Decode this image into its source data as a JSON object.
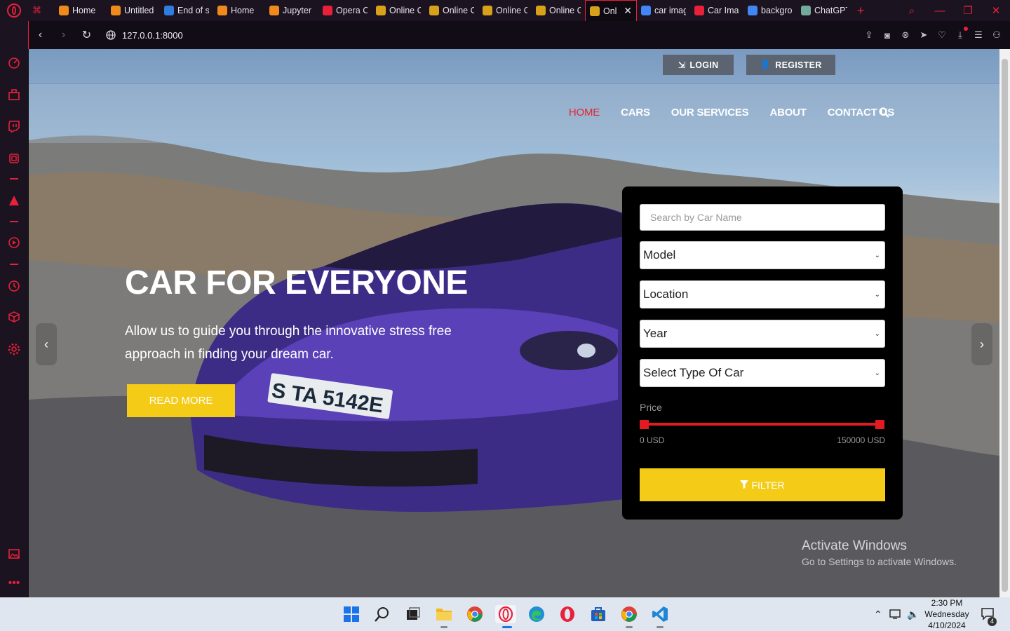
{
  "browser": {
    "tabs": [
      {
        "label": "Home",
        "color": "#f08a1c",
        "active": false
      },
      {
        "label": "Untitled",
        "color": "#f08a1c",
        "active": false
      },
      {
        "label": "End of s",
        "color": "#2f7de1",
        "active": false
      },
      {
        "label": "Home",
        "color": "#f08a1c",
        "active": false
      },
      {
        "label": "Jupyter",
        "color": "#f08a1c",
        "active": false
      },
      {
        "label": "Opera C",
        "color": "#e8203a",
        "active": false
      },
      {
        "label": "Online C",
        "color": "#d8a11a",
        "active": false
      },
      {
        "label": "Online C",
        "color": "#d8a11a",
        "active": false
      },
      {
        "label": "Online C",
        "color": "#d8a11a",
        "active": false
      },
      {
        "label": "Online C",
        "color": "#d8a11a",
        "active": false
      },
      {
        "label": "Onli",
        "color": "#d8a11a",
        "active": true
      },
      {
        "label": "car imag",
        "color": "#4285f4",
        "active": false
      },
      {
        "label": "Car Ima",
        "color": "#e8203a",
        "active": false
      },
      {
        "label": "backgro",
        "color": "#4285f4",
        "active": false
      },
      {
        "label": "ChatGPT",
        "color": "#74aa9c",
        "active": false
      }
    ],
    "url": "127.0.0.1:8000"
  },
  "header": {
    "login_label": "LOGIN",
    "register_label": "REGISTER"
  },
  "nav": {
    "items": [
      "HOME",
      "CARS",
      "OUR SERVICES",
      "ABOUT",
      "CONTACT US"
    ],
    "active": "HOME"
  },
  "hero": {
    "title": "CAR FOR EVERYONE",
    "subtitle": "Allow us to guide you through the innovative stress free approach in finding your dream car.",
    "cta_label": "READ MORE",
    "plate_text": "S TA 5142E"
  },
  "filter": {
    "search_placeholder": "Search by Car Name",
    "model_label": "Model",
    "location_label": "Location",
    "year_label": "Year",
    "type_label": "Select Type Of Car",
    "price_label": "Price",
    "price_min": "0 USD",
    "price_max": "150000 USD",
    "price_range_fraction": [
      0,
      1
    ],
    "button_label": "FILTER"
  },
  "watermark": {
    "line1": "Activate Windows",
    "line2": "Go to Settings to activate Windows."
  },
  "taskbar": {
    "time": "2:30 PM",
    "day": "Wednesday",
    "date": "4/10/2024",
    "notification_count": "4"
  },
  "colors": {
    "brand_red": "#e8203a",
    "accent_yellow": "#f4cc17",
    "nav_active": "#e4262e"
  }
}
